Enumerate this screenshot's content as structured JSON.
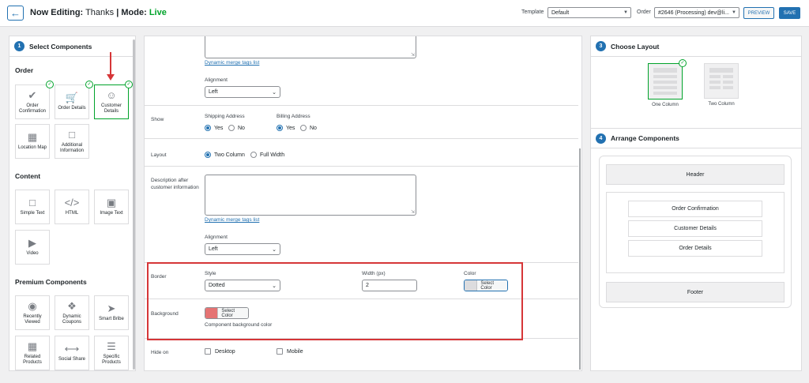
{
  "header": {
    "back_icon": "arrow-left-icon",
    "title_prefix": "Now Editing:",
    "title_name": "Thanks",
    "separator": "|",
    "mode_label": "Mode:",
    "mode_value": "Live",
    "template_label": "Template",
    "template_value": "Default",
    "order_label": "Order",
    "order_value": "#2646 (Processing) dev@li...",
    "preview_label": "PREVIEW",
    "save_label": "SAVE"
  },
  "left": {
    "step": "1",
    "title": "Select Components",
    "order_section": "Order",
    "order_items": [
      {
        "label": "Order Confirmation",
        "icon": "check-circle-icon"
      },
      {
        "label": "Order Details",
        "icon": "cart-icon"
      },
      {
        "label": "Customer Details",
        "icon": "user-icon"
      },
      {
        "label": "Location Map",
        "icon": "map-icon"
      },
      {
        "label": "Additional Information",
        "icon": "note-icon"
      }
    ],
    "content_section": "Content",
    "content_items": [
      {
        "label": "Simple Text",
        "icon": "text-icon"
      },
      {
        "label": "HTML",
        "icon": "code-icon"
      },
      {
        "label": "Image Text",
        "icon": "image-text-icon"
      },
      {
        "label": "Video",
        "icon": "video-icon"
      }
    ],
    "premium_section": "Premium Components",
    "premium_items": [
      {
        "label": "Recently Viewed",
        "icon": "eye-icon"
      },
      {
        "label": "Dynamic Coupons",
        "icon": "coupon-icon"
      },
      {
        "label": "Smart Bribe",
        "icon": "rocket-icon"
      },
      {
        "label": "Related Products",
        "icon": "grid-icon"
      },
      {
        "label": "Social Share",
        "icon": "share-icon"
      },
      {
        "label": "Specific Products",
        "icon": "list-icon"
      }
    ]
  },
  "center": {
    "merge_tags_link": "Dynamic merge tags list",
    "alignment_label": "Alignment",
    "alignment_value": "Left",
    "show_label": "Show",
    "shipping_label": "Shipping Address",
    "billing_label": "Billing Address",
    "yes": "Yes",
    "no": "No",
    "layout_label": "Layout",
    "two_column": "Two Column",
    "full_width": "Full Width",
    "description_label": "Description after customer information",
    "merge_tags_link_2": "Dynamic merge tags list",
    "alignment_label_2": "Alignment",
    "alignment_value_2": "Left",
    "border_label": "Border",
    "style_label": "Style",
    "style_value": "Dotted",
    "width_label": "Width (px)",
    "width_value": "2",
    "color_label": "Color",
    "select_color": "Select Color",
    "background_label": "Background",
    "background_select_color": "Select Color",
    "background_hint": "Component background color",
    "hide_on_label": "Hide on",
    "desktop": "Desktop",
    "mobile": "Mobile",
    "border_color": "#dcdcde",
    "background_color": "#e57373"
  },
  "right": {
    "step3": "3",
    "choose_layout": "Choose Layout",
    "one_column": "One Column",
    "two_column": "Two Column",
    "step4": "4",
    "arrange": "Arrange Components",
    "header_block": "Header",
    "components": [
      "Order Confirmation",
      "Customer Details",
      "Order Details"
    ],
    "footer_block": "Footer"
  },
  "colors": {
    "accent": "#2271b1",
    "live": "#00a32a",
    "highlight": "#d63638"
  }
}
